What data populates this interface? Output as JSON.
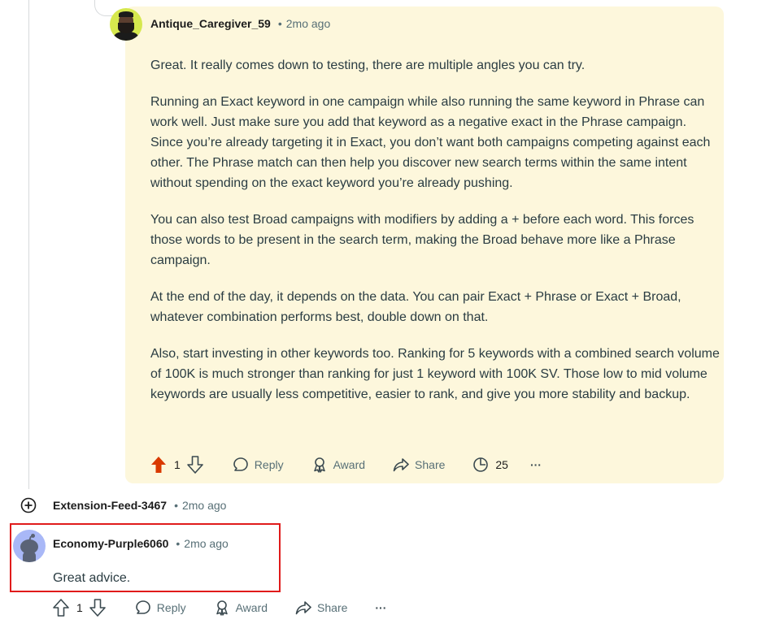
{
  "comment_main": {
    "username": "Antique_Caregiver_59",
    "time": "2mo ago",
    "paragraphs": [
      "Great. It really comes down to testing, there are multiple angles you can try.",
      "Running an Exact keyword in one campaign while also running the same keyword in Phrase can work well. Just make sure you add that keyword as a negative exact in the Phrase campaign. Since you’re already targeting it in Exact, you don’t want both campaigns competing against each other. The Phrase match can then help you discover new search terms within the same intent without spending on the exact keyword you’re already pushing.",
      "You can also test Broad campaigns with modifiers by adding a + before each word. This forces those words to be present in the search term, making the Broad behave more like a Phrase campaign.",
      "At the end of the day, it depends on the data. You can pair Exact + Phrase or Exact + Broad, whatever combination performs best, double down on that.",
      "Also, start investing in other keywords too. Ranking for 5 keywords with a combined search volume of 100K is much stronger than ranking for just 1 keyword with 100K SV. Those low to mid volume keywords are usually less competitive, easier to rank, and give you more stability and backup."
    ],
    "actions": {
      "vote_count": "1",
      "reply": "Reply",
      "award": "Award",
      "share": "Share",
      "insights_count": "25",
      "more": "···"
    },
    "upvote_color": "#d93900"
  },
  "comment_collapsed": {
    "username": "Extension-Feed-3467",
    "time": "2mo ago"
  },
  "comment_reply": {
    "username": "Economy-Purple6060",
    "time": "2mo ago",
    "text": "Great advice.",
    "actions": {
      "vote_count": "1",
      "reply": "Reply",
      "award": "Award",
      "share": "Share",
      "more": "···"
    }
  },
  "separator": "•",
  "colors": {
    "highlight_bg": "#fdf7dc",
    "annotation_border": "#e01b1b",
    "meta_gray": "#576f76"
  }
}
